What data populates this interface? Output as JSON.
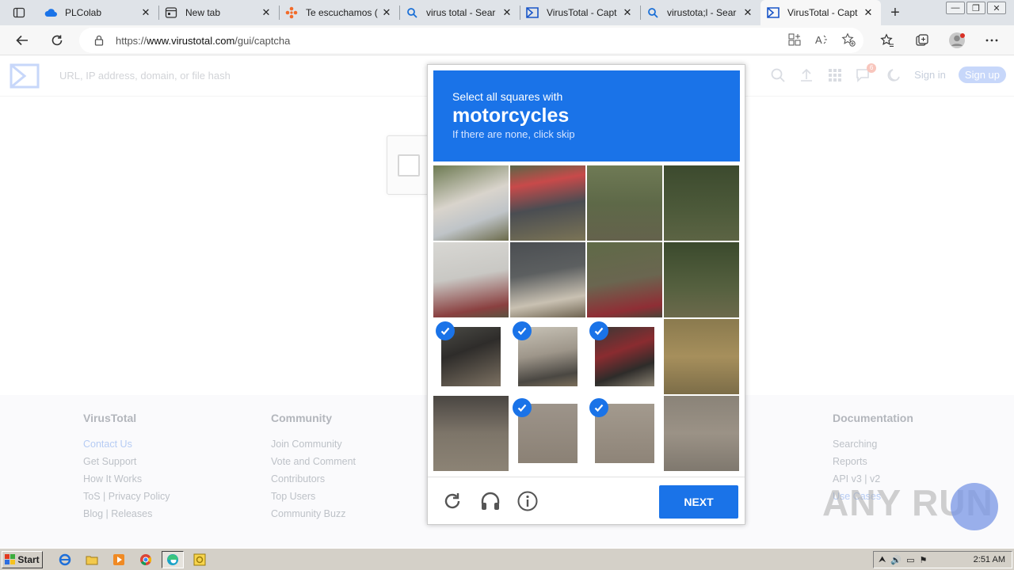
{
  "browser": {
    "tabs": [
      {
        "title": "PLColab",
        "icon": "cloud-icon",
        "active": false
      },
      {
        "title": "New tab",
        "icon": "newtab-icon",
        "active": false
      },
      {
        "title": "Te escuchamos (",
        "icon": "feedback-icon",
        "active": false
      },
      {
        "title": "virus total - Sear",
        "icon": "search-icon",
        "active": false
      },
      {
        "title": "VirusTotal - Capt",
        "icon": "virustotal-icon",
        "active": false
      },
      {
        "title": "virustota;l - Sear",
        "icon": "search-icon",
        "active": false
      },
      {
        "title": "VirusTotal - Capt",
        "icon": "virustotal-icon",
        "active": true
      }
    ],
    "url_prefix": "https://",
    "url_domain": "www.virustotal.com",
    "url_path": "/gui/captcha"
  },
  "vt": {
    "search_placeholder": "URL, IP address, domain, or file hash",
    "notification_count": "6",
    "signin": "Sign in",
    "signup": "Sign up"
  },
  "footer": {
    "columns": [
      {
        "heading": "VirusTotal",
        "links": [
          "Contact Us",
          "Get Support",
          "How It Works",
          "ToS | Privacy Policy",
          "Blog | Releases"
        ]
      },
      {
        "heading": "Community",
        "links": [
          "Join Community",
          "Vote and Comment",
          "Contributors",
          "Top Users",
          "Community Buzz"
        ]
      },
      {
        "heading": "Documentation",
        "links": [
          "Searching",
          "Reports",
          "API v3 | v2",
          "Use Cases"
        ]
      }
    ]
  },
  "captcha": {
    "instruction": "Select all squares with",
    "target": "motorcycles",
    "hint": "If there are none, click skip",
    "selected_tiles": [
      8,
      9,
      10,
      13,
      14
    ],
    "next_label": "NEXT"
  },
  "watermark": "ANY RUN",
  "taskbar": {
    "start_label": "Start",
    "time": "2:51 AM"
  }
}
